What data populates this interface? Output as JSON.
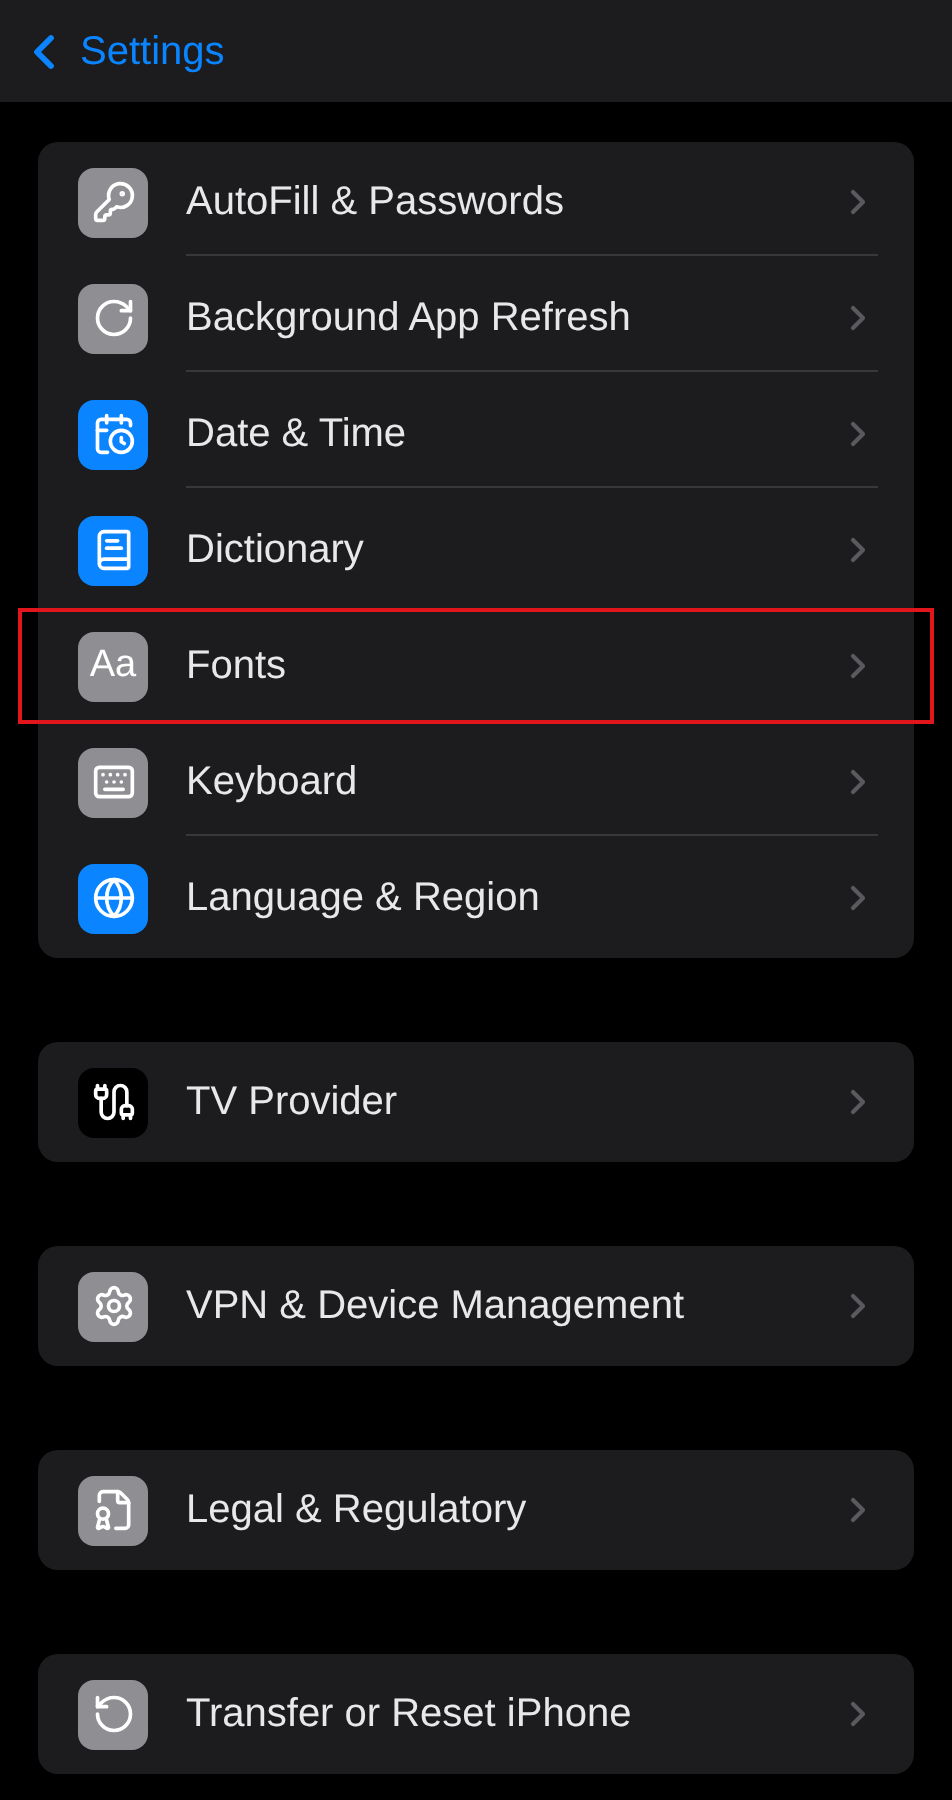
{
  "nav": {
    "back": "Settings"
  },
  "groups": [
    {
      "items": [
        {
          "label": "AutoFill & Passwords",
          "color": "#8e8e93",
          "highlighted": false
        },
        {
          "label": "Background App Refresh",
          "color": "#8e8e93",
          "highlighted": false
        },
        {
          "label": "Date & Time",
          "color": "#0a84ff",
          "highlighted": false
        },
        {
          "label": "Dictionary",
          "color": "#0a84ff",
          "highlighted": false
        },
        {
          "label": "Fonts",
          "color": "#8e8e93",
          "icon_text": "Aa",
          "highlighted": true
        },
        {
          "label": "Keyboard",
          "color": "#8e8e93",
          "highlighted": false
        },
        {
          "label": "Language & Region",
          "color": "#0a84ff",
          "highlighted": false
        }
      ]
    },
    {
      "items": [
        {
          "label": "TV Provider",
          "color": "#000000",
          "highlighted": false
        }
      ]
    },
    {
      "items": [
        {
          "label": "VPN & Device Management",
          "color": "#8e8e93",
          "highlighted": false
        }
      ]
    },
    {
      "items": [
        {
          "label": "Legal & Regulatory",
          "color": "#8e8e93",
          "highlighted": false
        }
      ]
    },
    {
      "items": [
        {
          "label": "Transfer or Reset iPhone",
          "color": "#8e8e93",
          "highlighted": false
        }
      ]
    }
  ]
}
